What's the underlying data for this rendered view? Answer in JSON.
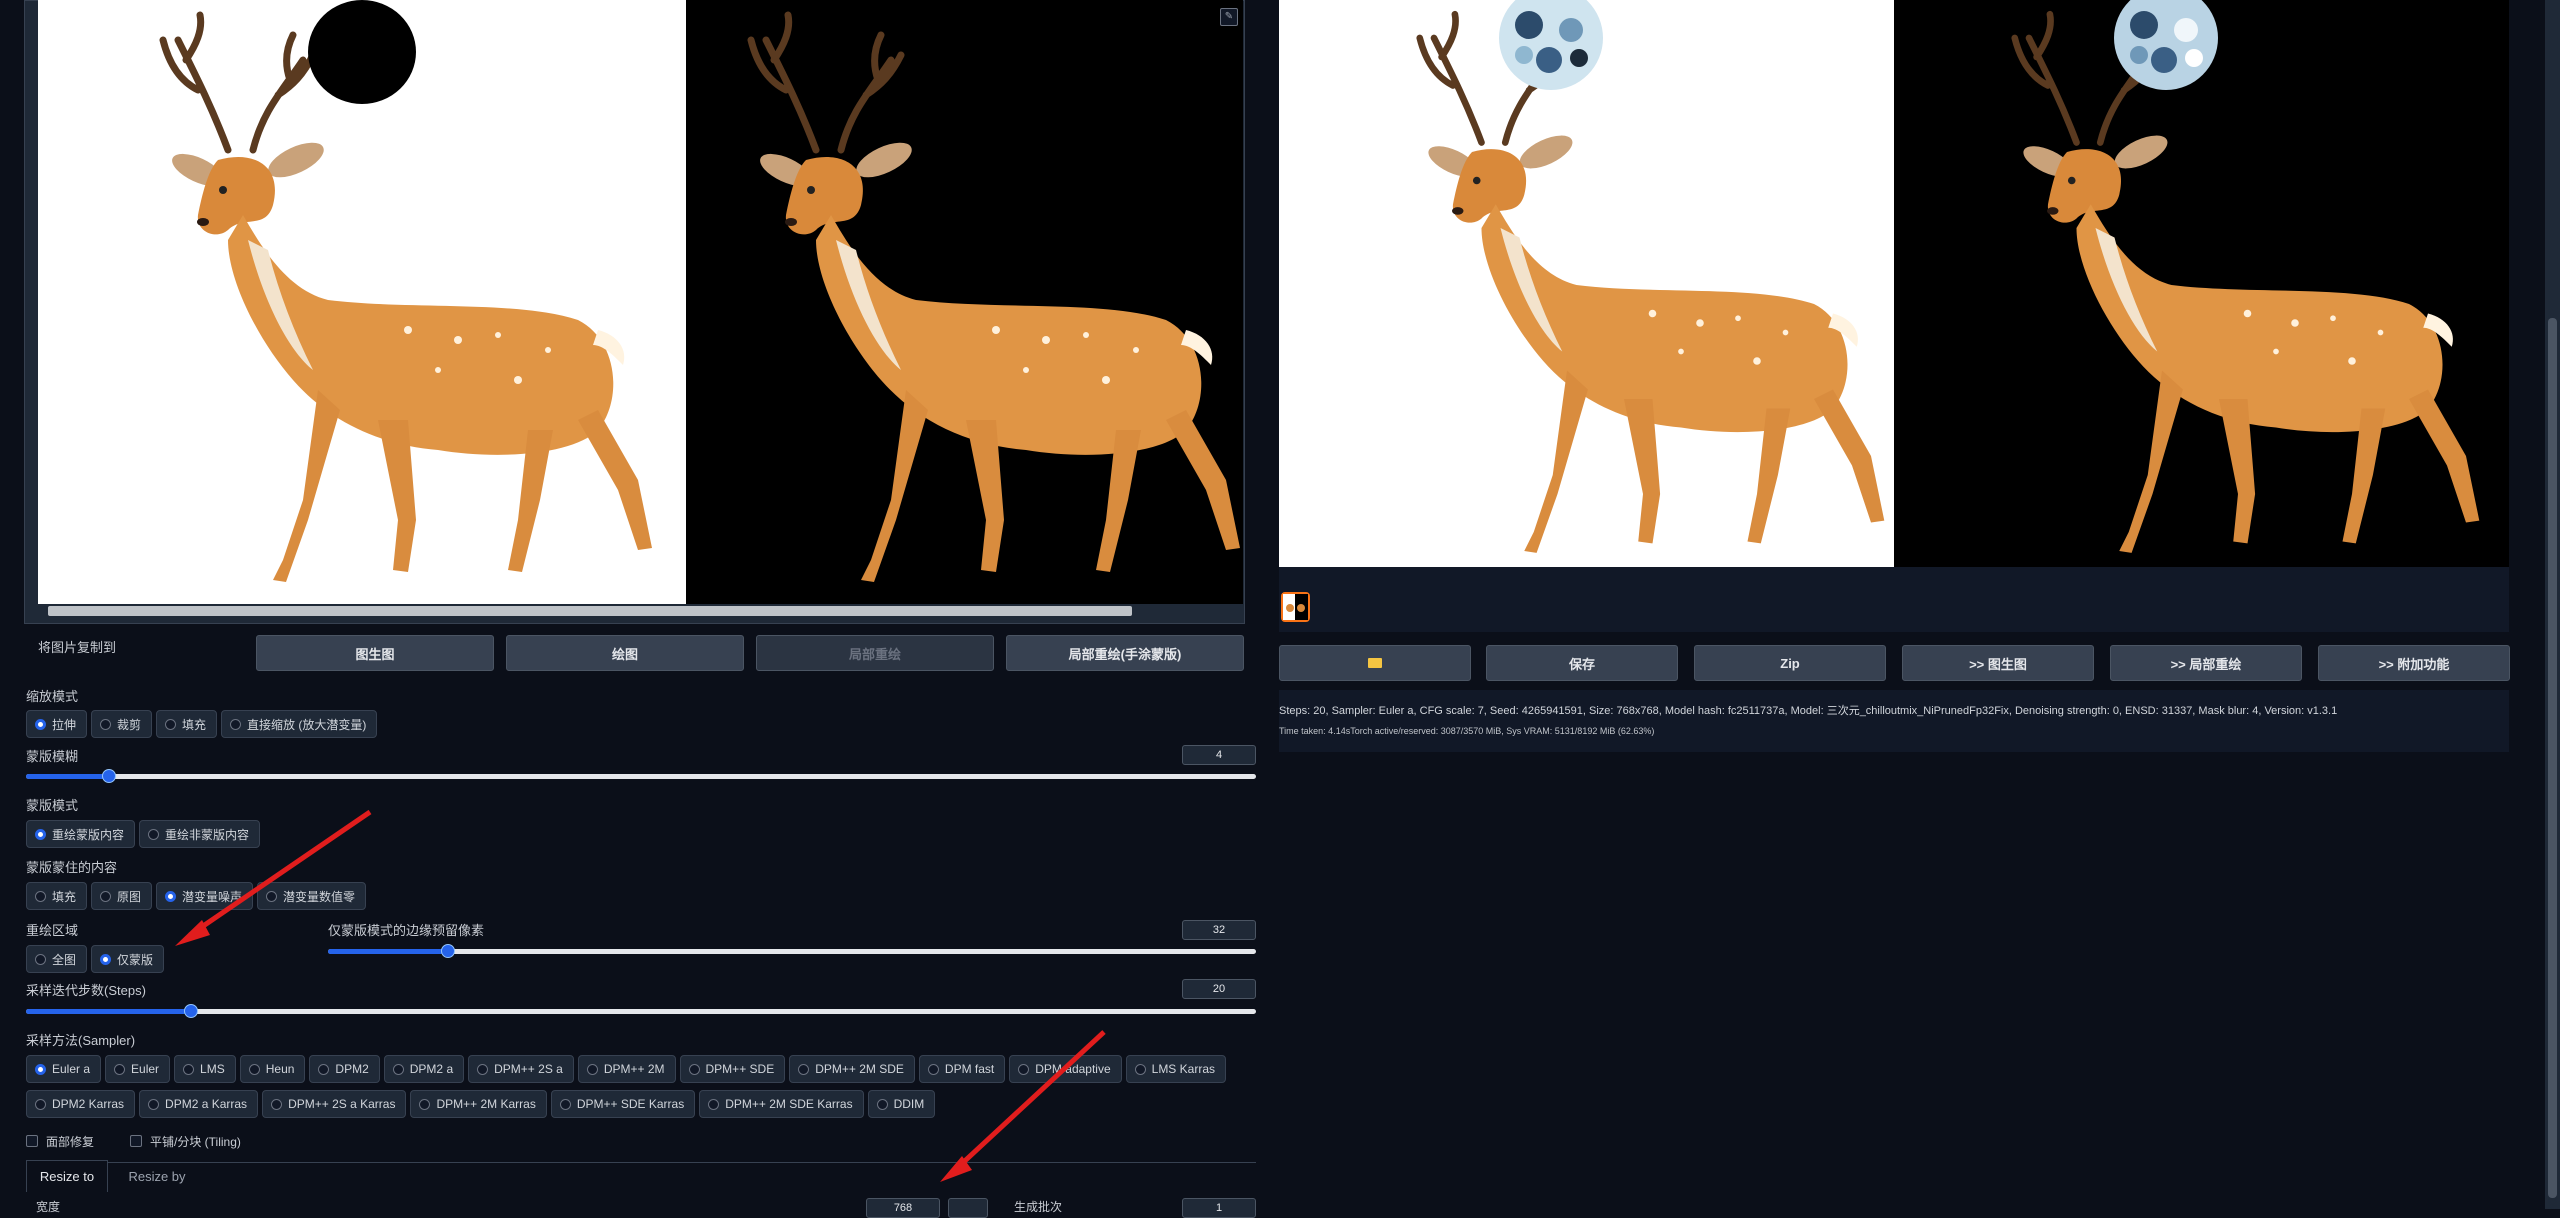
{
  "editor": {
    "copy_label": "将图片复制到",
    "copy_buttons": [
      "图生图",
      "绘图",
      "局部重绘",
      "局部重绘(手涂蒙版)"
    ]
  },
  "resize_mode": {
    "label": "缩放模式",
    "options": [
      "拉伸",
      "裁剪",
      "填充",
      "直接缩放 (放大潜变量)"
    ],
    "selected": "拉伸"
  },
  "mask_blur": {
    "label": "蒙版模糊",
    "value": "4",
    "fraction": 0.0625
  },
  "mask_mode": {
    "label": "蒙版模式",
    "options": [
      "重绘蒙版内容",
      "重绘非蒙版内容"
    ],
    "selected": "重绘蒙版内容"
  },
  "masked_content": {
    "label": "蒙版蒙住的内容",
    "options": [
      "填充",
      "原图",
      "潜变量噪声",
      "潜变量数值零"
    ],
    "selected": "潜变量噪声"
  },
  "inpaint_area": {
    "label": "重绘区域",
    "options": [
      "全图",
      "仅蒙版"
    ],
    "selected": "仅蒙版"
  },
  "only_masked_padding": {
    "label": "仅蒙版模式的边缘预留像素",
    "value": "32",
    "fraction": 0.125
  },
  "steps": {
    "label": "采样迭代步数(Steps)",
    "value": "20",
    "fraction": 0.133
  },
  "sampler": {
    "label": "采样方法(Sampler)",
    "row1": [
      "Euler a",
      "Euler",
      "LMS",
      "Heun",
      "DPM2",
      "DPM2 a",
      "DPM++ 2S a",
      "DPM++ 2M",
      "DPM++ SDE",
      "DPM++ 2M SDE",
      "DPM fast",
      "DPM adaptive",
      "LMS Karras"
    ],
    "row2": [
      "DPM2 Karras",
      "DPM2 a Karras",
      "DPM++ 2S a Karras",
      "DPM++ 2M Karras",
      "DPM++ SDE Karras",
      "DPM++ 2M SDE Karras",
      "DDIM"
    ],
    "selected": "Euler a"
  },
  "checks": {
    "face_restore": "面部修复",
    "tiling": "平铺/分块 (Tiling)"
  },
  "resize_tabs": [
    "Resize to",
    "Resize by"
  ],
  "bottom": {
    "width_label": "宽度",
    "width_value": "768",
    "batch_label": "生成批次",
    "batch_value": "1"
  },
  "output": {
    "buttons": [
      "保存",
      "Zip",
      ">> 图生图",
      ">> 局部重绘",
      ">> 附加功能"
    ],
    "folder_icon": "folder-icon",
    "info_line": "Steps: 20, Sampler: Euler a, CFG scale: 7, Seed: 4265941591, Size: 768x768, Model hash: fc2511737a, Model: 三次元_chilloutmix_NiPrunedFp32Fix, Denoising strength: 0, ENSD: 31337, Mask blur: 4, Version: v1.3.1",
    "time_line": "Time taken: 4.14sTorch active/reserved: 3087/3570 MiB, Sys VRAM: 5131/8192 MiB (62.63%)"
  },
  "colors": {
    "accent": "#2563eb",
    "annotation_arrow": "#e11d1d",
    "thumb_border": "#f97316"
  }
}
